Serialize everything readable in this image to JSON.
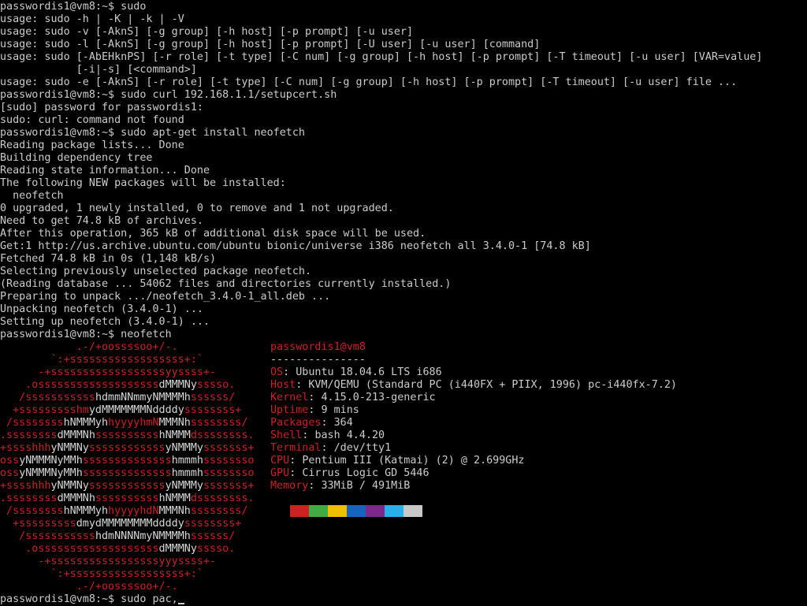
{
  "terminal": {
    "lines": [
      "passwordis1@vm8:~$ sudo",
      "usage: sudo -h | -K | -k | -V",
      "usage: sudo -v [-AknS] [-g group] [-h host] [-p prompt] [-u user]",
      "usage: sudo -l [-AknS] [-g group] [-h host] [-p prompt] [-U user] [-u user] [command]",
      "usage: sudo [-AbEHknPS] [-r role] [-t type] [-C num] [-g group] [-h host] [-p prompt] [-T timeout] [-u user] [VAR=value]",
      "            [-i|-s] [<command>]",
      "usage: sudo -e [-AknS] [-r role] [-t type] [-C num] [-g group] [-h host] [-p prompt] [-T timeout] [-u user] file ...",
      "passwordis1@vm8:~$ sudo curl 192.168.1.1/setupcert.sh",
      "[sudo] password for passwordis1:",
      "sudo: curl: command not found",
      "passwordis1@vm8:~$ sudo apt-get install neofetch",
      "Reading package lists... Done",
      "Building dependency tree",
      "Reading state information... Done",
      "The following NEW packages will be installed:",
      "  neofetch",
      "0 upgraded, 1 newly installed, 0 to remove and 1 not upgraded.",
      "Need to get 74.8 kB of archives.",
      "After this operation, 365 kB of additional disk space will be used.",
      "Get:1 http://us.archive.ubuntu.com/ubuntu bionic/universe i386 neofetch all 3.4.0-1 [74.8 kB]",
      "Fetched 74.8 kB in 0s (1,148 kB/s)",
      "Selecting previously unselected package neofetch.",
      "(Reading database ... 54062 files and directories currently installed.)",
      "Preparing to unpack .../neofetch_3.4.0-1_all.deb ...",
      "Unpacking neofetch (3.4.0-1) ...",
      "Setting up neofetch (3.4.0-1) ...",
      "passwordis1@vm8:~$ neofetch"
    ],
    "prompt_input": "passwordis1@vm8:~$ sudo pac,"
  },
  "neofetch": {
    "logo": [
      "            .-/+oossssoo+/-.",
      "        `:+ssssssssssssssssss+:`",
      "      -+ssssssssssssssssssyyssss+-",
      "    .osssssssssssssssssssdMMMNysssso.",
      "   /ssssssssssshdmmNNmmyNMMMMhssssss/",
      "  +ssssssssshmydMMMMMMMNddddyssssssss+",
      " /sssssssshNMMMyhhyyyyhmNMMMNhssssssss/",
      ".ssssssssdMMMNhsssssssssshNMMMdssssssss.",
      "+sssshhhyNMMNyssssssssssssyNMMMysssssss+",
      "ossyNMMMNyMMhsssssssssssssshmmmhssssssso",
      "ossyNMMMNyMMhsssssssssssssshmmmhssssssso",
      "+sssshhhyNMMNyssssssssssssyNMMMysssssss+",
      ".ssssssssdMMMNhsssssssssshNMMMdssssssss.",
      " /sssssssshNMMMyhhyyyyhdNMMMNhssssssss/",
      "  +sssssssssdmydMMMMMMMMddddyssssssss+",
      "   /ssssssssssshdmNNNNmyNMMMMhssssss/",
      "    .osssssssssssssssssssdMMMNysssso.",
      "      -+sssssssssssssssssyyyssss+-",
      "        `:+ssssssssssssssssss+:`",
      "            .-/+oossssoo+/-."
    ],
    "title": "passwordis1@vm8",
    "separator": "---------------",
    "info": [
      {
        "key": "OS",
        "value": "Ubuntu 18.04.6 LTS i686"
      },
      {
        "key": "Host",
        "value": "KVM/QEMU (Standard PC (i440FX + PIIX, 1996) pc-i440fx-7.2)"
      },
      {
        "key": "Kernel",
        "value": "4.15.0-213-generic"
      },
      {
        "key": "Uptime",
        "value": "9 mins"
      },
      {
        "key": "Packages",
        "value": "364"
      },
      {
        "key": "Shell",
        "value": "bash 4.4.20"
      },
      {
        "key": "Terminal",
        "value": "/dev/tty1"
      },
      {
        "key": "CPU",
        "value": "Pentium III (Katmai) (2) @ 2.699GHz"
      },
      {
        "key": "GPU",
        "value": "Cirrus Logic GD 5446"
      },
      {
        "key": "Memory",
        "value": "33MiB / 491MiB"
      }
    ],
    "palette": [
      "#cc2222",
      "#44aa44",
      "#f0c000",
      "#1565c0",
      "#7b2a8a",
      "#29b0e8",
      "#c8c8c8"
    ]
  },
  "colors": {
    "background": "#000000",
    "foreground": "#cccccc",
    "accent_red": "#cc2222",
    "logo_white": "#d8d8d8"
  }
}
